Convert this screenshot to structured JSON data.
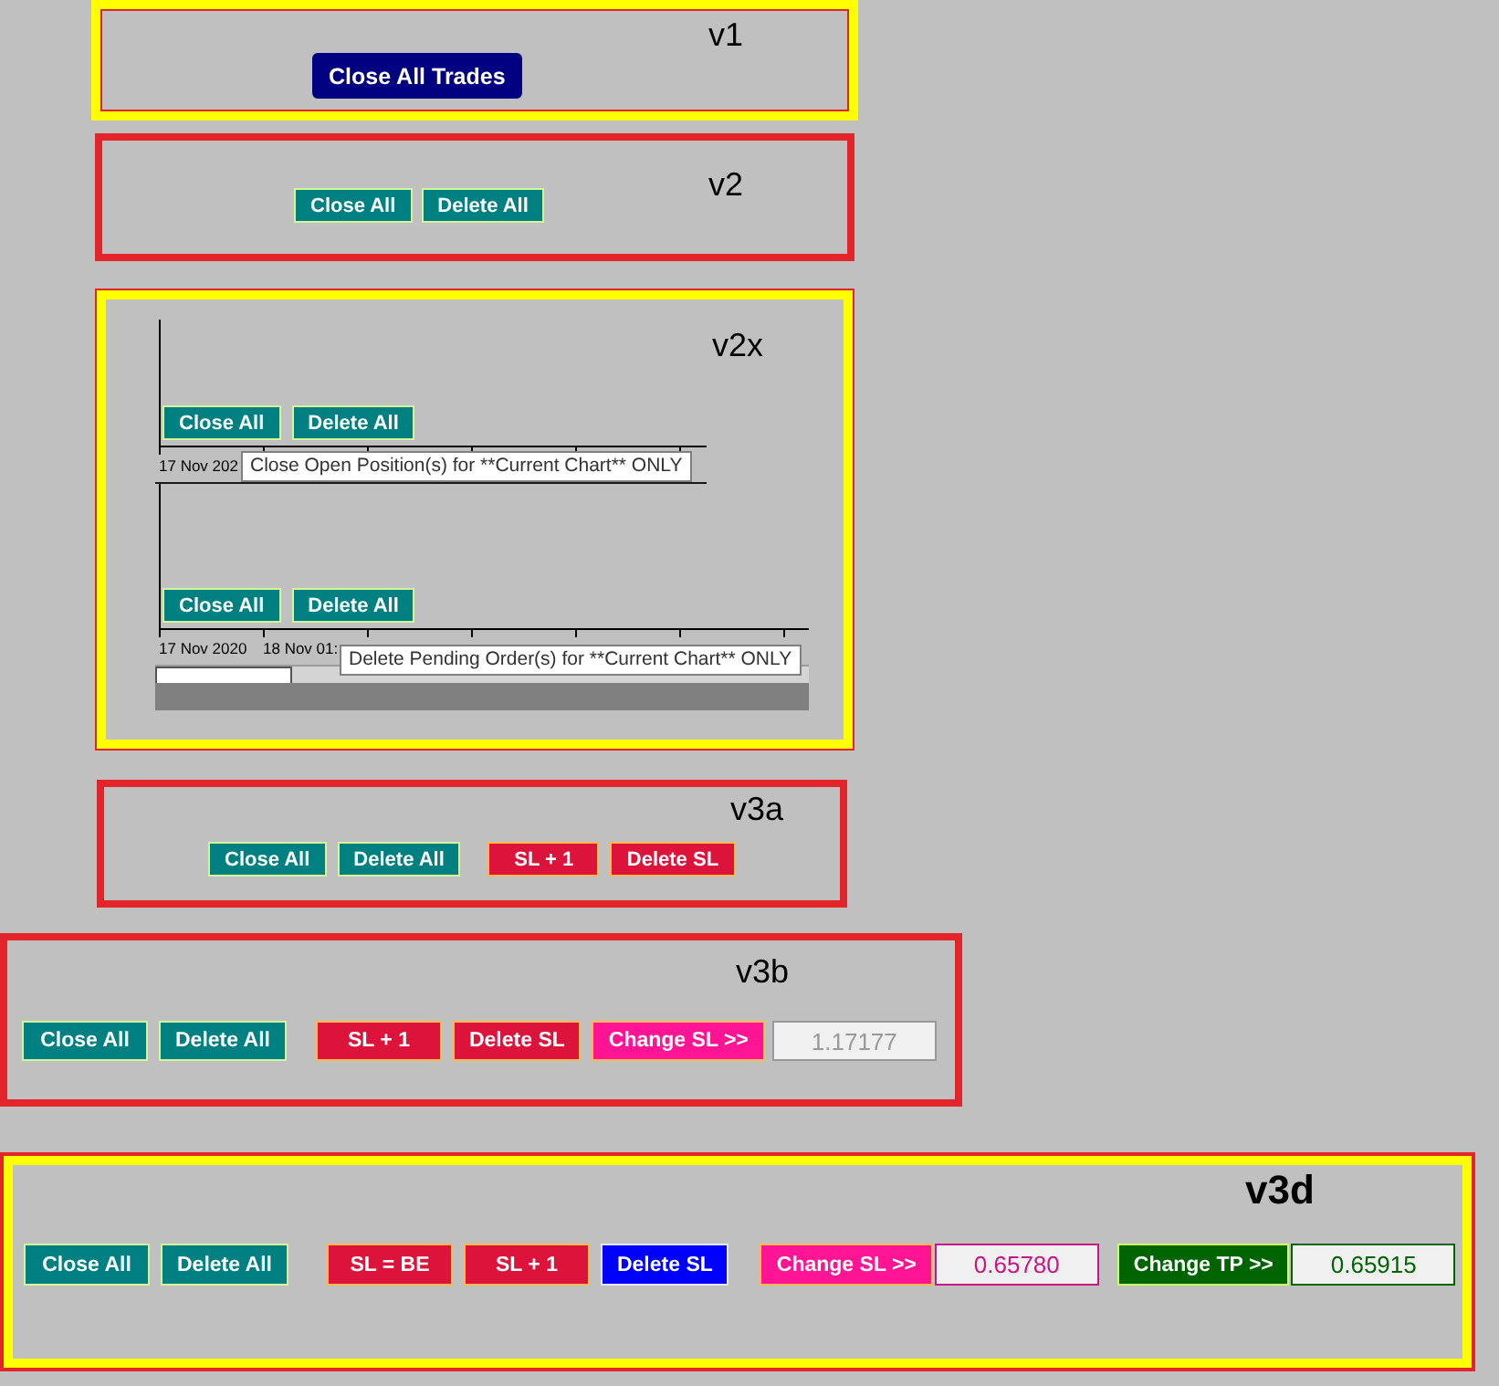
{
  "panels": [
    {
      "kind": "toolbar",
      "label": "v1",
      "emphasized": false,
      "color": "#ffff00",
      "groups": [
        [
          {
            "kind": "button",
            "label": "Close All Trades",
            "color": "#000080"
          }
        ]
      ]
    },
    {
      "kind": "toolbar",
      "label": "v2",
      "emphasized": false,
      "color": "#e3242b",
      "groups": [
        [
          {
            "kind": "button",
            "label": "Close All",
            "color": "#008080"
          },
          {
            "kind": "button",
            "label": "Delete All",
            "color": "#008080"
          }
        ]
      ]
    },
    {
      "kind": "chart_capture",
      "label": "v2x",
      "emphasized": false,
      "color": "#ffff00",
      "chart_window": {
        "panes": [
          {
            "buttons": [
              {
                "label": "Close All",
                "color": "#008080"
              },
              {
                "label": "Delete All",
                "color": "#008080"
              }
            ],
            "dates": [
              "17 Nov 202"
            ],
            "tooltip": "Close Open Position(s) for **Current Chart** ONLY"
          },
          {
            "buttons": [
              {
                "label": "Close All",
                "color": "#008080"
              },
              {
                "label": "Delete All",
                "color": "#008080"
              }
            ],
            "dates": [
              "17 Nov 2020",
              "18 Nov 01:"
            ],
            "tooltip": "Delete Pending Order(s) for **Current Chart** ONLY"
          }
        ]
      }
    },
    {
      "kind": "toolbar",
      "label": "v3a",
      "emphasized": false,
      "color": "#e3242b",
      "groups": [
        [
          {
            "kind": "button",
            "label": "Close All",
            "color": "#008080"
          },
          {
            "kind": "button",
            "label": "Delete All",
            "color": "#008080"
          }
        ],
        [
          {
            "kind": "button",
            "label": "SL + 1",
            "color": "#dc143c"
          },
          {
            "kind": "button",
            "label": "Delete SL",
            "color": "#dc143c"
          }
        ]
      ]
    },
    {
      "kind": "toolbar",
      "label": "v3b",
      "emphasized": false,
      "color": "#e3242b",
      "groups": [
        [
          {
            "kind": "button",
            "label": "Close All",
            "color": "#008080"
          },
          {
            "kind": "button",
            "label": "Delete All",
            "color": "#008080"
          }
        ],
        [
          {
            "kind": "button",
            "label": "SL + 1",
            "color": "#dc143c"
          },
          {
            "kind": "button",
            "label": "Delete SL",
            "color": "#dc143c"
          },
          {
            "kind": "button",
            "label": "Change SL >>",
            "color": "#ff1493"
          },
          {
            "kind": "field",
            "value": "1.17177",
            "color": "#999999"
          }
        ]
      ]
    },
    {
      "kind": "toolbar",
      "label": "v3d",
      "emphasized": true,
      "color": "#ffff00",
      "groups": [
        [
          {
            "kind": "button",
            "label": "Close All",
            "color": "#008080"
          },
          {
            "kind": "button",
            "label": "Delete All",
            "color": "#008080"
          }
        ],
        [
          {
            "kind": "button",
            "label": "SL = BE",
            "color": "#dc143c"
          },
          {
            "kind": "button",
            "label": "SL + 1",
            "color": "#dc143c"
          },
          {
            "kind": "button",
            "label": "Delete SL",
            "color": "#0000ff"
          }
        ],
        [
          {
            "kind": "button",
            "label": "Change SL >>",
            "color": "#ff1493"
          },
          {
            "kind": "field",
            "value": "0.65780",
            "color": "#c71585"
          }
        ],
        [
          {
            "kind": "button",
            "label": "Change TP >>",
            "color": "#006400"
          },
          {
            "kind": "field",
            "value": "0.65915",
            "color": "#006400"
          }
        ]
      ]
    }
  ]
}
